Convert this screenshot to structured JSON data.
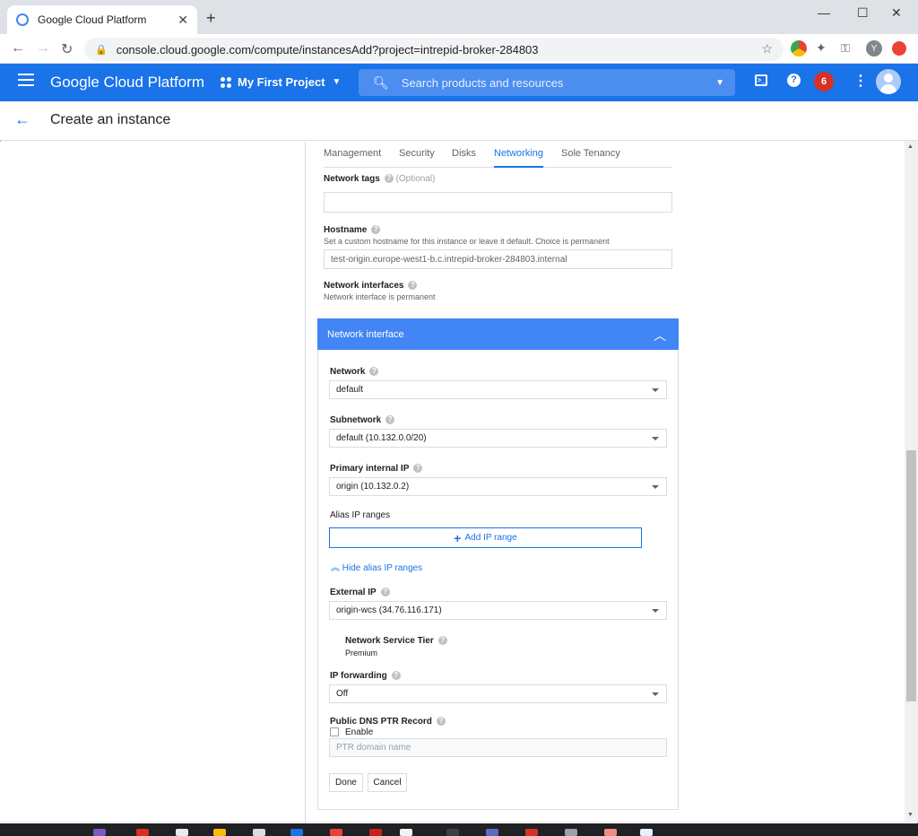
{
  "browser": {
    "tab_title": "Google Cloud Platform",
    "url": "console.cloud.google.com/compute/instancesAdd?project=intrepid-broker-284803",
    "new_tab_label": "+",
    "profile_initial": "Y"
  },
  "header": {
    "brand": "Google Cloud Platform",
    "project": "My First Project",
    "search_placeholder": "Search products and resources",
    "notification_count": "6"
  },
  "page": {
    "title": "Create an instance"
  },
  "tabs": [
    "Management",
    "Security",
    "Disks",
    "Networking",
    "Sole Tenancy"
  ],
  "active_tab": "Networking",
  "form": {
    "network_tags_label": "Network tags",
    "network_tags_optional": "(Optional)",
    "network_tags_value": "",
    "hostname_label": "Hostname",
    "hostname_desc": "Set a custom hostname for this instance or leave it default. Choice is permanent",
    "hostname_value": "test-origin.europe-west1-b.c.intrepid-broker-284803.internal",
    "network_interfaces_label": "Network interfaces",
    "network_interfaces_desc": "Network interface is permanent"
  },
  "network_interface": {
    "header": "Network interface",
    "network_label": "Network",
    "network_value": "default",
    "subnetwork_label": "Subnetwork",
    "subnetwork_value": "default (10.132.0.0/20)",
    "primary_ip_label": "Primary internal IP",
    "primary_ip_value": "origin (10.132.0.2)",
    "alias_label": "Alias IP ranges",
    "add_ip_range": "Add IP range",
    "hide_alias": "Hide alias IP ranges",
    "external_ip_label": "External IP",
    "external_ip_value": "origin-wcs (34.76.116.171)",
    "service_tier_label": "Network Service Tier",
    "service_tier_value": "Premium",
    "ip_forwarding_label": "IP forwarding",
    "ip_forwarding_value": "Off",
    "dns_label": "Public DNS PTR Record",
    "enable_label": "Enable",
    "ptr_placeholder": "PTR domain name",
    "done_label": "Done",
    "cancel_label": "Cancel"
  },
  "colors": {
    "brand_blue": "#1a73e8",
    "panel_blue": "#4285f4",
    "badge_red": "#d93025"
  }
}
